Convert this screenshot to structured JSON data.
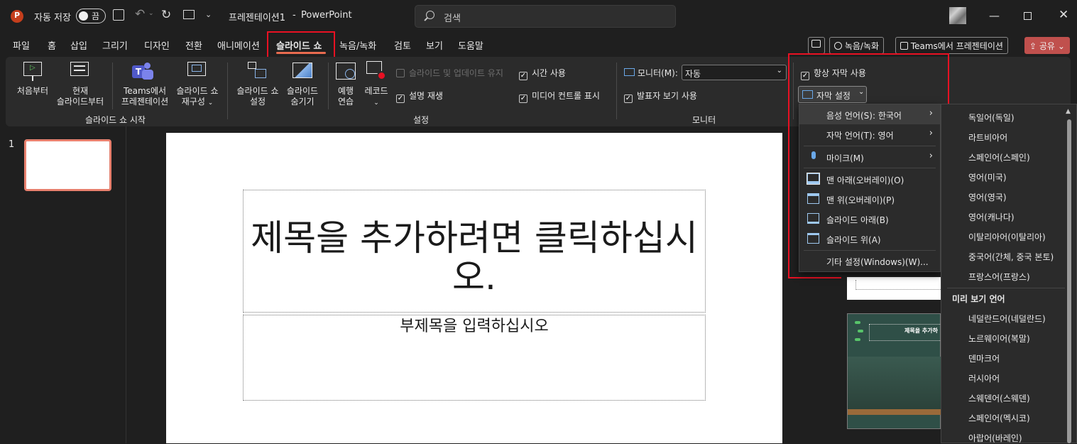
{
  "titlebar": {
    "autosave_label": "자동 저장",
    "autosave_state": "끔",
    "doc_title": "프레젠테이션1",
    "separator": "-",
    "app_name": "PowerPoint",
    "search_placeholder": "검색"
  },
  "tabs": [
    {
      "label": "파일"
    },
    {
      "label": "홈"
    },
    {
      "label": "삽입"
    },
    {
      "label": "그리기"
    },
    {
      "label": "디자인"
    },
    {
      "label": "전환"
    },
    {
      "label": "애니메이션"
    },
    {
      "label": "슬라이드 쇼"
    },
    {
      "label": "녹음/녹화"
    },
    {
      "label": "검토"
    },
    {
      "label": "보기"
    },
    {
      "label": "도움말"
    }
  ],
  "tab_buttons": {
    "record": "녹음/녹화",
    "teams": "Teams에서 프레젠테이션",
    "share": "공유"
  },
  "ribbon": {
    "from_start": "처음부터",
    "from_current_1": "현재",
    "from_current_2": "슬라이드부터",
    "teams_1": "Teams에서",
    "teams_2": "프레젠테이션",
    "custom_1": "슬라이드 쇼",
    "custom_2": "재구성",
    "group_start": "슬라이드 쇼 시작",
    "setup_1": "슬라이드 쇼",
    "setup_2": "설정",
    "hide_1": "슬라이드",
    "hide_2": "숨기기",
    "rehearse_1": "예행",
    "rehearse_2": "연습",
    "record": "레코드",
    "keep_updated": "슬라이드 및 업데이트 유지",
    "play_narrations": "설명 재생",
    "use_timings": "시간 사용",
    "media_controls": "미디어 컨트롤 표시",
    "group_setup": "설정",
    "monitor_label": "모니터(M):",
    "monitor_value": "자동",
    "presenter_view": "발표자 보기 사용",
    "group_monitor": "모니터",
    "always_captions": "항상 자막 사용",
    "caption_settings": "자막 설정"
  },
  "slide": {
    "number": "1",
    "title_placeholder": "제목을 추가하려면 클릭하십시오.",
    "subtitle_placeholder": "부제목을 입력하십시오"
  },
  "caption_menu": {
    "items": [
      {
        "label": "음성 언어(S): 한국어"
      },
      {
        "label": "자막 언어(T): 영어"
      },
      {
        "label": "마이크(M)"
      },
      {
        "label": "맨 아래(오버레이)(O)"
      },
      {
        "label": "맨 위(오버레이)(P)"
      },
      {
        "label": "슬라이드 아래(B)"
      },
      {
        "label": "슬라이드 위(A)"
      },
      {
        "label": "기타 설정(Windows)(W)..."
      }
    ]
  },
  "language_menu": {
    "items": [
      "독일어(독일)",
      "라트비아어",
      "스페인어(스페인)",
      "영어(미국)",
      "영어(영국)",
      "영어(캐나다)",
      "이탈리아어(이탈리아)",
      "중국어(간체, 중국 본토)",
      "프랑스어(프랑스)"
    ],
    "preview_heading": "미리 보기 언어",
    "preview_items": [
      "네덜란드어(네덜란드)",
      "노르웨이어(복말)",
      "덴마크어",
      "러시아어",
      "스웨덴어(스웨덴)",
      "스페인어(멕시코)",
      "아랍어(바레인)"
    ]
  },
  "thumbnail": {
    "title": "제목을 추가하"
  },
  "colors": {
    "accent": "#e86b4f",
    "highlight_box": "#e81123",
    "share_button": "#c0504d"
  }
}
